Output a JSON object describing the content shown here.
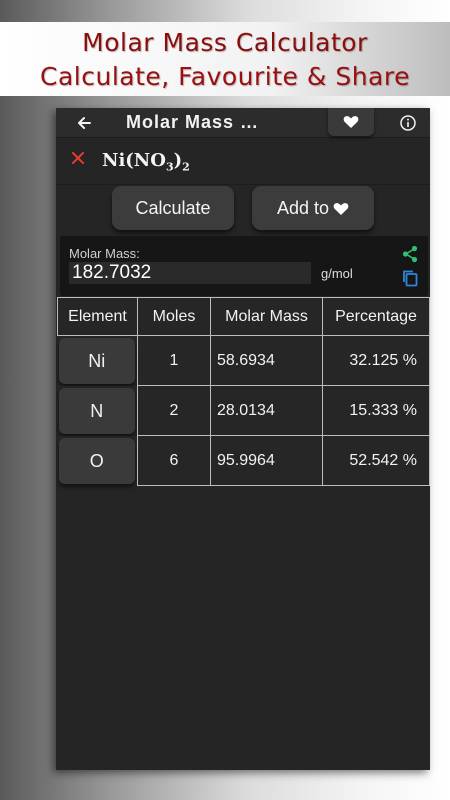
{
  "promo": {
    "line1": "Molar Mass Calculator",
    "line2": "Calculate, Favourite & Share",
    "text_color": "#8b0d0d"
  },
  "appbar": {
    "title": "Molar Mass …",
    "icons": [
      "back-arrow-icon",
      "heart-icon",
      "info-icon"
    ]
  },
  "formula": {
    "prefix": "Ni(NO",
    "sub1": "3",
    "close": ")",
    "sub2": "2",
    "clear_icon": "close-icon",
    "clear_color": "#e53935"
  },
  "buttons": {
    "calculate": "Calculate",
    "add_to": "Add to"
  },
  "result": {
    "label": "Molar Mass:",
    "value": "182.7032",
    "unit": "g/mol",
    "share_color": "#2fbf71",
    "copy_color": "#2e86de"
  },
  "table": {
    "headers": [
      "Element",
      "Moles",
      "Molar Mass",
      "Percentage"
    ],
    "rows": [
      {
        "element": "Ni",
        "moles": "1",
        "molar_mass": "58.6934",
        "percentage": "32.125 %"
      },
      {
        "element": "N",
        "moles": "2",
        "molar_mass": "28.0134",
        "percentage": "15.333 %"
      },
      {
        "element": "O",
        "moles": "6",
        "molar_mass": "95.9964",
        "percentage": "52.542 %"
      }
    ]
  }
}
